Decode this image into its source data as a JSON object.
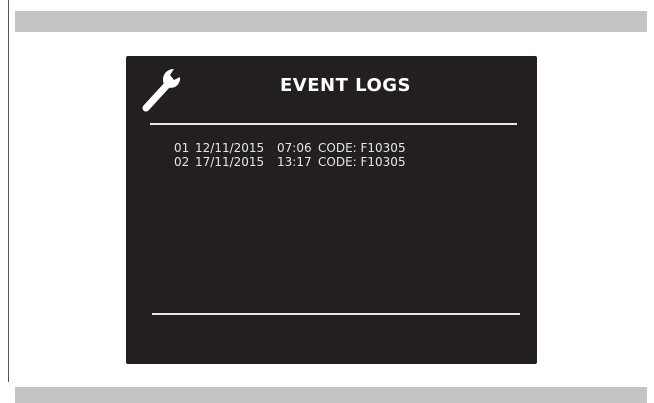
{
  "screen": {
    "title": "EVENT LOGS",
    "icon": "wrench-icon",
    "colors": {
      "background": "#231f20",
      "text": "#ffffff",
      "frame_band": "#c4c4c4"
    }
  },
  "logs": [
    {
      "index": "01",
      "date": "12/11/2015",
      "time": "07:06",
      "code": "CODE: F10305"
    },
    {
      "index": "02",
      "date": "17/11/2015",
      "time": "13:17",
      "code": "CODE: F10305"
    }
  ]
}
